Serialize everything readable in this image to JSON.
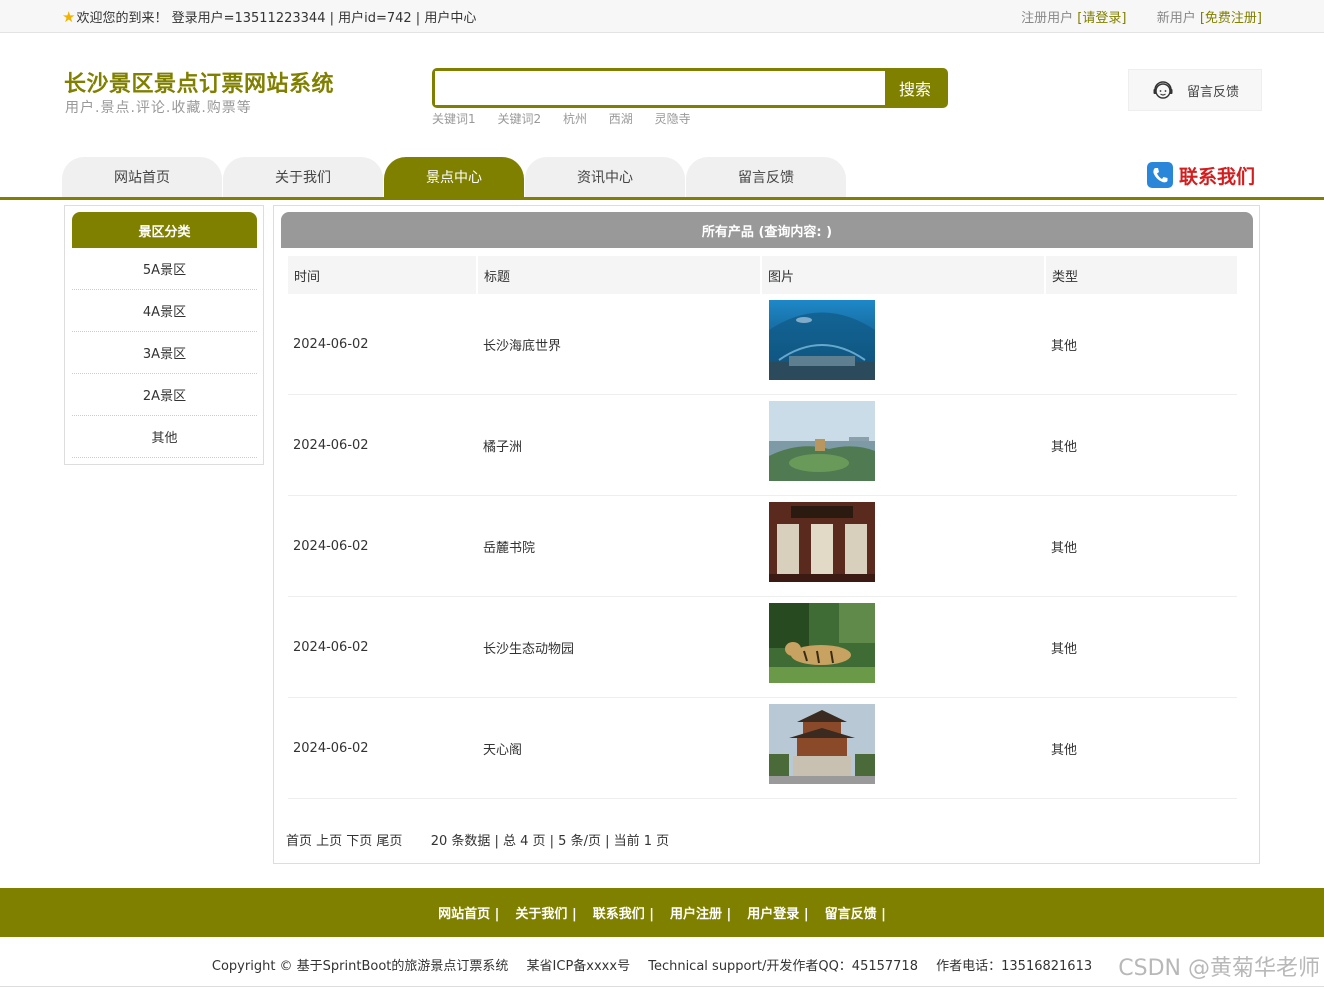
{
  "topbar": {
    "welcome": "欢迎您的到来！ 登录用户=13511223344 | 用户id=742 | 用户中心",
    "register_text": "注册用户",
    "login_link": "[请登录]",
    "new_user_text": "新用户",
    "free_register_link": "[免费注册]"
  },
  "header": {
    "title": "长沙景区景点订票网站系统",
    "subtitle": "用户.景点.评论.收藏.购票等",
    "search": {
      "value": "",
      "placeholder": "",
      "button": "搜索"
    },
    "keywords": [
      "关键词1",
      "关键词2",
      "杭州",
      "西湖",
      "灵隐寺"
    ],
    "feedback_label": "留言反馈"
  },
  "nav": {
    "tabs": [
      "网站首页",
      "关于我们",
      "景点中心",
      "资讯中心",
      "留言反馈"
    ],
    "active_index": 2,
    "contact": "联系我们"
  },
  "sidebar": {
    "title": "景区分类",
    "items": [
      "5A景区",
      "4A景区",
      "3A景区",
      "2A景区",
      "其他"
    ]
  },
  "main": {
    "title": "所有产品 (查询内容: )",
    "columns": [
      "时间",
      "标题",
      "图片",
      "类型"
    ],
    "rows": [
      {
        "time": "2024-06-02",
        "title": "长沙海底世界",
        "image": "aquarium-tunnel",
        "type": "其他"
      },
      {
        "time": "2024-06-02",
        "title": "橘子洲",
        "image": "island-river-view",
        "type": "其他"
      },
      {
        "time": "2024-06-02",
        "title": "岳麓书院",
        "image": "academy-hall",
        "type": "其他"
      },
      {
        "time": "2024-06-02",
        "title": "长沙生态动物园",
        "image": "tiger-zoo",
        "type": "其他"
      },
      {
        "time": "2024-06-02",
        "title": "天心阁",
        "image": "pavilion-tower",
        "type": "其他"
      }
    ],
    "pager": {
      "links": "首页 上页 下页 尾页",
      "info": "20 条数据 | 总 4 页 | 5 条/页 | 当前 1 页"
    }
  },
  "footer": {
    "links": [
      "网站首页",
      "关于我们",
      "联系我们",
      "用户注册",
      "用户登录",
      "留言反馈"
    ],
    "copyright": "Copyright © 基于SprintBoot的旅游景点订票系统",
    "icp": "某省ICP备xxxx号",
    "support": "Technical support/开发作者QQ：45157718",
    "phone": "作者电话：13516821613",
    "watermark": "CSDN @黄菊华老师"
  },
  "colors": {
    "accent": "#808000",
    "header_gray": "#999999",
    "contact_red": "#d21e1e"
  }
}
